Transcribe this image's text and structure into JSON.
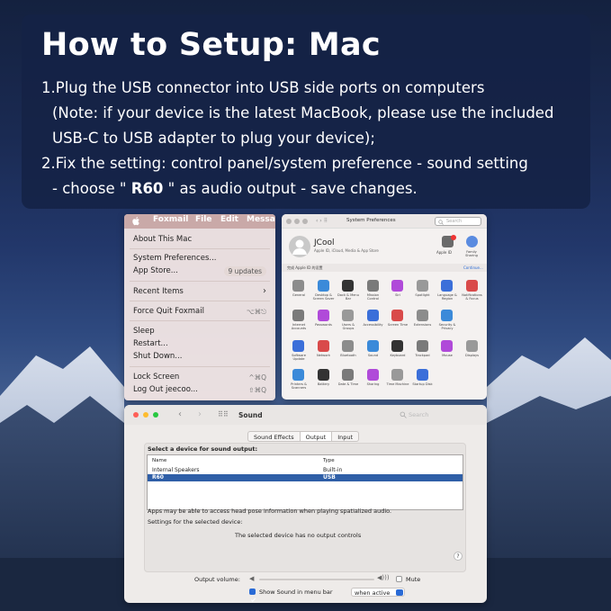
{
  "header": {
    "title": "How to Setup: Mac",
    "step1_line1": "1.Plug the USB connector into USB side ports on computers",
    "step1_line2": "(Note: if your device is the latest MacBook, please use the included",
    "step1_line3": "USB-C to USB adapter to plug your device);",
    "step2_line1": "2.Fix the setting: control panel/system preference - sound setting",
    "step2_line2_pre": "- choose \" ",
    "step2_line2_device": "R60",
    "step2_line2_post": " \" as audio output - save changes."
  },
  "apple_menu": {
    "menubar": [
      "Foxmail",
      "File",
      "Edit",
      "Messag"
    ],
    "items": [
      {
        "label": "About This Mac"
      },
      {
        "label": "System Preferences..."
      },
      {
        "label": "App Store...",
        "badge": "9 updates"
      },
      {
        "label": "Recent Items",
        "arrow": "›"
      },
      {
        "label": "Force Quit Foxmail",
        "shortcut": "⌥⌘⎋"
      },
      {
        "label": "Sleep"
      },
      {
        "label": "Restart..."
      },
      {
        "label": "Shut Down..."
      },
      {
        "label": "Lock Screen",
        "shortcut": "^⌘Q"
      },
      {
        "label": "Log Out jeecoo...",
        "shortcut": "⇧⌘Q"
      }
    ]
  },
  "system_preferences": {
    "title": "System Preferences",
    "search_placeholder": "Search",
    "user_name": "JCool",
    "user_sub": "Apple ID, iCloud, Media & App Store",
    "apple_id_label": "Apple ID",
    "family_label": "Family Sharing",
    "suggestion": "完成 Apple ID 的设置",
    "continue": "Continue...",
    "panes_row1": [
      "General",
      "Desktop & Screen Saver",
      "Dock & Menu Bar",
      "Mission Control",
      "Siri",
      "Spotlight",
      "Language & Region",
      "Notifications & Focus"
    ],
    "panes_row2": [
      "Internet Accounts",
      "Passwords",
      "Users & Groups",
      "Accessibility",
      "Screen Time",
      "Extensions",
      "Security & Privacy"
    ],
    "panes_row3": [
      "Software Update",
      "Network",
      "Bluetooth",
      "Sound",
      "Keyboard",
      "Trackpad",
      "Mouse",
      "Displays"
    ],
    "panes_row4": [
      "Printers & Scanners",
      "Battery",
      "Date & Time",
      "Sharing",
      "Time Machine",
      "Startup Disk"
    ]
  },
  "sound": {
    "title": "Sound",
    "search_placeholder": "Search",
    "tabs": [
      "Sound Effects",
      "Output",
      "Input"
    ],
    "active_tab": "Output",
    "select_label": "Select a device for sound output:",
    "col_name": "Name",
    "col_type": "Type",
    "devices": [
      {
        "name": "Internal Speakers",
        "type": "Built-in"
      },
      {
        "name": "R60",
        "type": "USB"
      }
    ],
    "selected_device": "R60",
    "spatial_note": "Apps may be able to access head pose information when playing spatialized audio.",
    "settings_label": "Settings for the selected device:",
    "no_controls": "The selected device has no output controls",
    "help": "?",
    "output_volume_label": "Output volume:",
    "mute_label": "Mute",
    "show_sound_label": "Show Sound in menu bar",
    "show_sound_checked": true,
    "when_option": "when active"
  }
}
